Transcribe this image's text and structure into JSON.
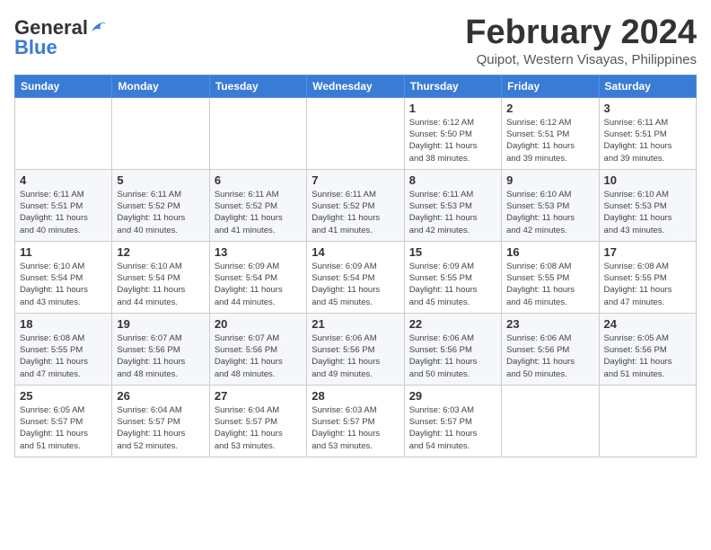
{
  "logo": {
    "general": "General",
    "blue": "Blue"
  },
  "title": {
    "month_year": "February 2024",
    "location": "Quipot, Western Visayas, Philippines"
  },
  "headers": [
    "Sunday",
    "Monday",
    "Tuesday",
    "Wednesday",
    "Thursday",
    "Friday",
    "Saturday"
  ],
  "weeks": [
    [
      {
        "day": "",
        "info": ""
      },
      {
        "day": "",
        "info": ""
      },
      {
        "day": "",
        "info": ""
      },
      {
        "day": "",
        "info": ""
      },
      {
        "day": "1",
        "info": "Sunrise: 6:12 AM\nSunset: 5:50 PM\nDaylight: 11 hours\nand 38 minutes."
      },
      {
        "day": "2",
        "info": "Sunrise: 6:12 AM\nSunset: 5:51 PM\nDaylight: 11 hours\nand 39 minutes."
      },
      {
        "day": "3",
        "info": "Sunrise: 6:11 AM\nSunset: 5:51 PM\nDaylight: 11 hours\nand 39 minutes."
      }
    ],
    [
      {
        "day": "4",
        "info": "Sunrise: 6:11 AM\nSunset: 5:51 PM\nDaylight: 11 hours\nand 40 minutes."
      },
      {
        "day": "5",
        "info": "Sunrise: 6:11 AM\nSunset: 5:52 PM\nDaylight: 11 hours\nand 40 minutes."
      },
      {
        "day": "6",
        "info": "Sunrise: 6:11 AM\nSunset: 5:52 PM\nDaylight: 11 hours\nand 41 minutes."
      },
      {
        "day": "7",
        "info": "Sunrise: 6:11 AM\nSunset: 5:52 PM\nDaylight: 11 hours\nand 41 minutes."
      },
      {
        "day": "8",
        "info": "Sunrise: 6:11 AM\nSunset: 5:53 PM\nDaylight: 11 hours\nand 42 minutes."
      },
      {
        "day": "9",
        "info": "Sunrise: 6:10 AM\nSunset: 5:53 PM\nDaylight: 11 hours\nand 42 minutes."
      },
      {
        "day": "10",
        "info": "Sunrise: 6:10 AM\nSunset: 5:53 PM\nDaylight: 11 hours\nand 43 minutes."
      }
    ],
    [
      {
        "day": "11",
        "info": "Sunrise: 6:10 AM\nSunset: 5:54 PM\nDaylight: 11 hours\nand 43 minutes."
      },
      {
        "day": "12",
        "info": "Sunrise: 6:10 AM\nSunset: 5:54 PM\nDaylight: 11 hours\nand 44 minutes."
      },
      {
        "day": "13",
        "info": "Sunrise: 6:09 AM\nSunset: 5:54 PM\nDaylight: 11 hours\nand 44 minutes."
      },
      {
        "day": "14",
        "info": "Sunrise: 6:09 AM\nSunset: 5:54 PM\nDaylight: 11 hours\nand 45 minutes."
      },
      {
        "day": "15",
        "info": "Sunrise: 6:09 AM\nSunset: 5:55 PM\nDaylight: 11 hours\nand 45 minutes."
      },
      {
        "day": "16",
        "info": "Sunrise: 6:08 AM\nSunset: 5:55 PM\nDaylight: 11 hours\nand 46 minutes."
      },
      {
        "day": "17",
        "info": "Sunrise: 6:08 AM\nSunset: 5:55 PM\nDaylight: 11 hours\nand 47 minutes."
      }
    ],
    [
      {
        "day": "18",
        "info": "Sunrise: 6:08 AM\nSunset: 5:55 PM\nDaylight: 11 hours\nand 47 minutes."
      },
      {
        "day": "19",
        "info": "Sunrise: 6:07 AM\nSunset: 5:56 PM\nDaylight: 11 hours\nand 48 minutes."
      },
      {
        "day": "20",
        "info": "Sunrise: 6:07 AM\nSunset: 5:56 PM\nDaylight: 11 hours\nand 48 minutes."
      },
      {
        "day": "21",
        "info": "Sunrise: 6:06 AM\nSunset: 5:56 PM\nDaylight: 11 hours\nand 49 minutes."
      },
      {
        "day": "22",
        "info": "Sunrise: 6:06 AM\nSunset: 5:56 PM\nDaylight: 11 hours\nand 50 minutes."
      },
      {
        "day": "23",
        "info": "Sunrise: 6:06 AM\nSunset: 5:56 PM\nDaylight: 11 hours\nand 50 minutes."
      },
      {
        "day": "24",
        "info": "Sunrise: 6:05 AM\nSunset: 5:56 PM\nDaylight: 11 hours\nand 51 minutes."
      }
    ],
    [
      {
        "day": "25",
        "info": "Sunrise: 6:05 AM\nSunset: 5:57 PM\nDaylight: 11 hours\nand 51 minutes."
      },
      {
        "day": "26",
        "info": "Sunrise: 6:04 AM\nSunset: 5:57 PM\nDaylight: 11 hours\nand 52 minutes."
      },
      {
        "day": "27",
        "info": "Sunrise: 6:04 AM\nSunset: 5:57 PM\nDaylight: 11 hours\nand 53 minutes."
      },
      {
        "day": "28",
        "info": "Sunrise: 6:03 AM\nSunset: 5:57 PM\nDaylight: 11 hours\nand 53 minutes."
      },
      {
        "day": "29",
        "info": "Sunrise: 6:03 AM\nSunset: 5:57 PM\nDaylight: 11 hours\nand 54 minutes."
      },
      {
        "day": "",
        "info": ""
      },
      {
        "day": "",
        "info": ""
      }
    ]
  ]
}
